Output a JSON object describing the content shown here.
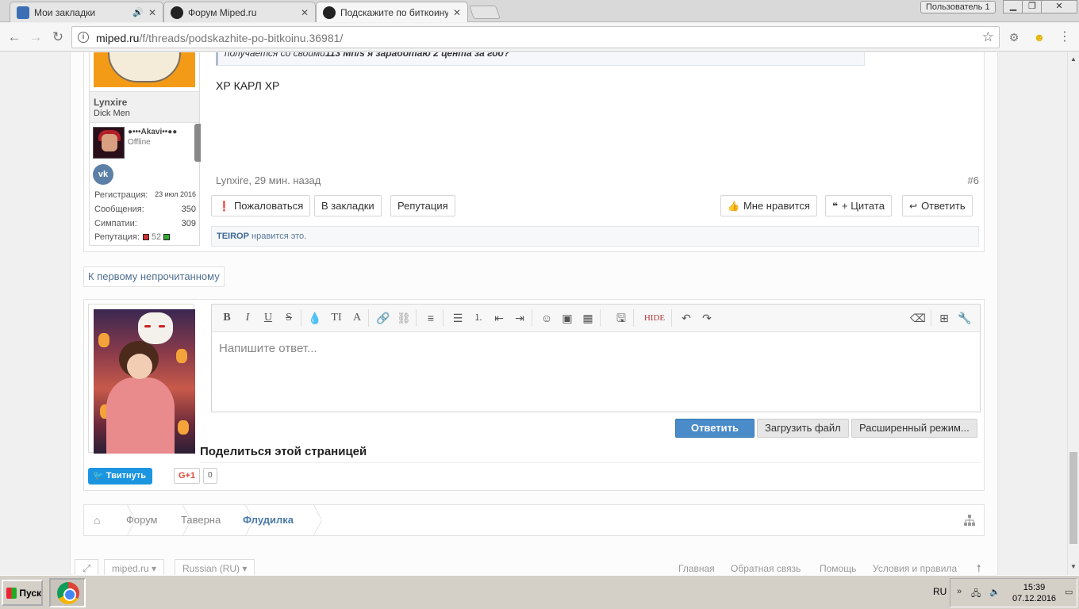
{
  "browser": {
    "tabs": [
      {
        "label": "Мои закладки",
        "active": false
      },
      {
        "label": "Форум Miped.ru",
        "active": false
      },
      {
        "label": "Подскажите по биткоину",
        "active": true
      }
    ],
    "profile_label": "Пользователь 1",
    "url_host": "miped.ru",
    "url_path": "/f/threads/podskazhite-po-bitkoinu.36981/"
  },
  "post": {
    "user": {
      "name": "Lynxire",
      "title": "Dick Men",
      "clan_name": "●•••Akavi••●●",
      "clan_status": "Offline",
      "vk_label": "vk",
      "stats": [
        {
          "label": "Регистрация:",
          "value": "23 июл 2016"
        },
        {
          "label": "Сообщения:",
          "value": "350"
        },
        {
          "label": "Симпатии:",
          "value": "309"
        },
        {
          "label": "Репутация:",
          "value": "52"
        }
      ]
    },
    "quote_prefix": "получается со своими",
    "quote_bold": "113 Mh/s я заработаю 2 цента за год?",
    "message": "ХР КАРЛ ХР",
    "meta": "Lynxire, 29 мин. назад",
    "number": "#6",
    "actions_left": [
      "Пожаловаться",
      "В закладки",
      "Репутация"
    ],
    "actions_right": [
      "Мне нравится",
      "+ Цитата",
      "Ответить"
    ],
    "likes_user": "TEIROP",
    "likes_text": " нравится это."
  },
  "first_unread": "К первому непрочитанному",
  "reply": {
    "placeholder": "Напишите ответ...",
    "hide_label": "HIDE",
    "buttons": [
      "Ответить",
      "Загрузить файл",
      "Расширенный режим..."
    ]
  },
  "share": {
    "title": "Поделиться этой страницей",
    "tweet": "Твитнуть",
    "gplus": "G+1",
    "gplus_count": "0"
  },
  "breadcrumb": [
    "Форум",
    "Таверна",
    "Флудилка"
  ],
  "footer": {
    "site_select": "miped.ru",
    "lang_select": "Russian (RU)",
    "links": [
      "Главная",
      "Обратная связь",
      "Помощь",
      "Условия и правила"
    ]
  },
  "taskbar": {
    "start": "Пуск",
    "lang": "RU",
    "time": "15:39",
    "date": "07.12.2016"
  },
  "colors": {
    "accent_blue": "#4a8bc9",
    "link_blue": "#4a7aa8",
    "tweet_blue": "#1b95e0"
  }
}
